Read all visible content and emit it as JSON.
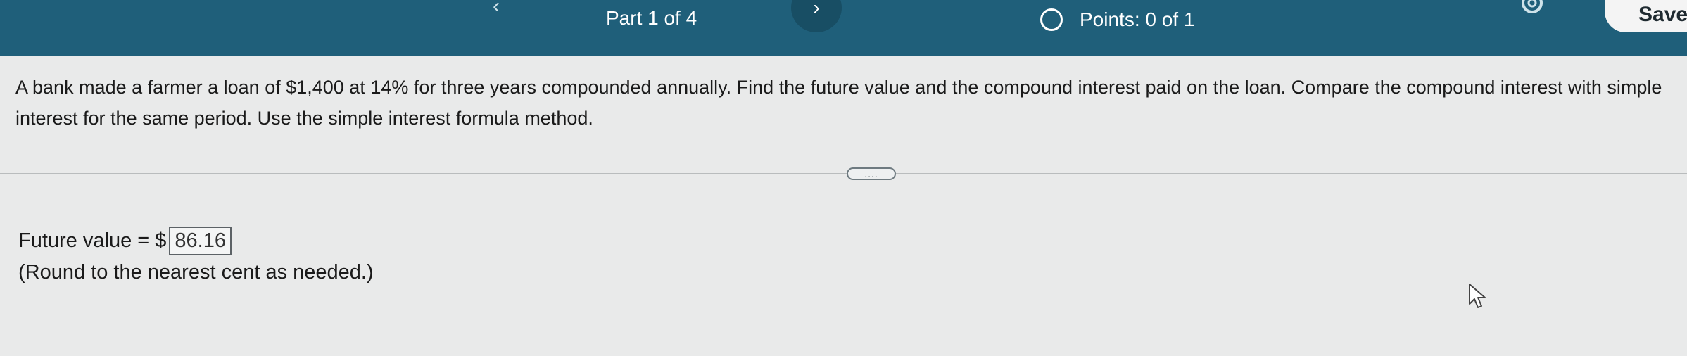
{
  "header": {
    "prev_icon": "chevron-left-icon",
    "part_label": "Part 1 of 4",
    "next_icon": "chevron-right-icon",
    "points_label": "Points: 0 of 1",
    "settings_icon": "gear-icon",
    "save_label": "Save",
    "colors": {
      "bar": "#1f5f7a",
      "text": "#ffffff"
    }
  },
  "question": {
    "text": "A bank made a farmer a loan of $1,400 at 14% for three years compounded annually. Find the future value and the compound interest paid on the loan. Compare the compound interest with simple interest for the same period. Use the simple interest formula method."
  },
  "expand_button_label": "....",
  "answer": {
    "prefix": "Future value = $",
    "value": "86.16",
    "hint": "(Round to the nearest cent as needed.)"
  },
  "cursor": "mouse-pointer-icon"
}
